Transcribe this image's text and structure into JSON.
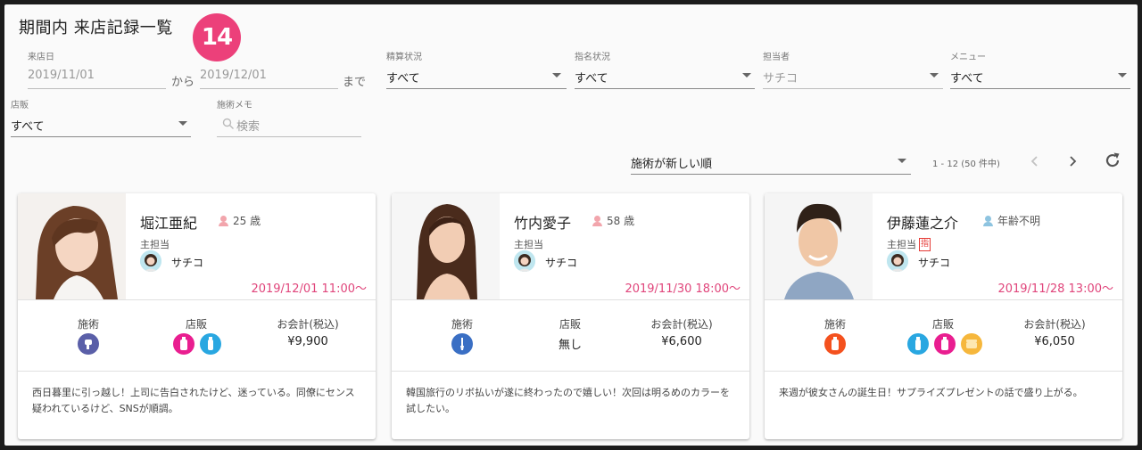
{
  "page": {
    "title": "期間内 来店記録一覧",
    "count_badge": "14"
  },
  "filters": {
    "visit_date": {
      "label": "来店日",
      "from": "2019/11/01",
      "from_suffix": "から",
      "to": "2019/12/01",
      "to_suffix": "まで"
    },
    "settlement": {
      "label": "精算状況",
      "value": "すべて"
    },
    "nomination": {
      "label": "指名状況",
      "value": "すべて"
    },
    "staff": {
      "label": "担当者",
      "value": "サチコ"
    },
    "menu": {
      "label": "メニュー",
      "value": "すべて"
    },
    "retail": {
      "label": "店販",
      "value": "すべて"
    },
    "memo": {
      "label": "施術メモ",
      "placeholder": "検索"
    }
  },
  "sort": {
    "value": "施術が新しい順"
  },
  "pager": {
    "range": "1 - 12 (50 件中)"
  },
  "colors": {
    "accent": "#e0457b",
    "badge": "#ec407a",
    "icon_pink": "#e91e90",
    "icon_blue": "#29a7e1",
    "icon_indigo": "#5a5fa8",
    "icon_red": "#f4511e",
    "icon_yellow": "#f6b73c"
  },
  "cards": [
    {
      "name": "堀江亜紀",
      "age": "25 歳",
      "age_icon_color": "#f2a5ac",
      "main_staff_label": "主担当",
      "nominated": false,
      "staff": "サチコ",
      "date": "2019/12/01 11:00〜",
      "stats": {
        "treatment_label": "施術",
        "retail_label": "店販",
        "total_label": "お会計(税込)",
        "total": "¥9,900",
        "retail_text": ""
      },
      "treatment_icons": [
        {
          "name": "dryer-icon",
          "color": "#5a5fa8"
        }
      ],
      "retail_icons": [
        {
          "name": "pink-bottle-icon",
          "color": "#e91e90"
        },
        {
          "name": "blue-bottle-icon",
          "color": "#29a7e1"
        }
      ],
      "memo": "西日暮里に引っ越し！上司に告白されたけど、迷っている。同僚にセンス疑われているけど、SNSが順調。"
    },
    {
      "name": "竹内愛子",
      "age": "58 歳",
      "age_icon_color": "#f2a5ac",
      "main_staff_label": "主担当",
      "nominated": false,
      "staff": "サチコ",
      "date": "2019/11/30 18:00〜",
      "stats": {
        "treatment_label": "施術",
        "retail_label": "店販",
        "total_label": "お会計(税込)",
        "total": "¥6,600",
        "retail_text": "無し"
      },
      "treatment_icons": [
        {
          "name": "brush-icon",
          "color": "#3a6fc4"
        }
      ],
      "retail_icons": [],
      "memo": "韓国旅行のリボ払いが遂に終わったので嬉しい！次回は明るめのカラーを試したい。"
    },
    {
      "name": "伊藤蓮之介",
      "age": "年齢不明",
      "age_icon_color": "#8ec4e0",
      "main_staff_label": "主担当",
      "nominated": true,
      "nominated_label": "指",
      "staff": "サチコ",
      "date": "2019/11/28 13:00〜",
      "stats": {
        "treatment_label": "施術",
        "retail_label": "店販",
        "total_label": "お会計(税込)",
        "total": "¥6,050",
        "retail_text": ""
      },
      "treatment_icons": [
        {
          "name": "red-bottle-icon",
          "color": "#f4511e"
        }
      ],
      "retail_icons": [
        {
          "name": "blue-bottle-icon",
          "color": "#29a7e1"
        },
        {
          "name": "pink-bottle-icon",
          "color": "#e91e90"
        },
        {
          "name": "wax-jar-icon",
          "color": "#f6b73c"
        }
      ],
      "memo": "来週が彼女さんの誕生日！サプライズプレゼントの話で盛り上がる。"
    }
  ]
}
